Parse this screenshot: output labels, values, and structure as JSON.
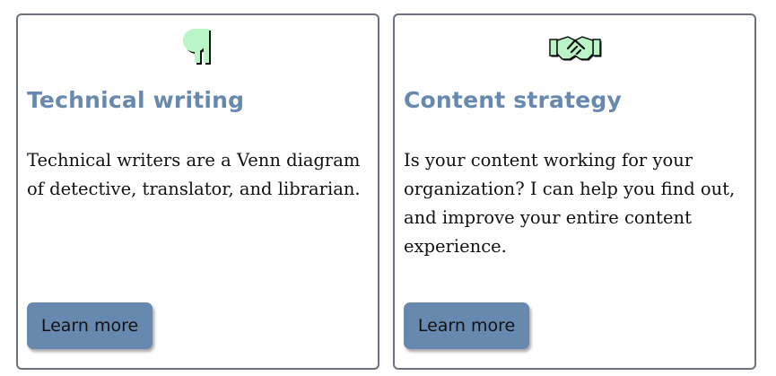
{
  "cards": [
    {
      "icon": "pilcrow-icon",
      "title": "Technical writing",
      "text": "Technical writers are a Venn diagram of detective, translator, and librarian.",
      "button_label": "Learn more"
    },
    {
      "icon": "handshake-icon",
      "title": "Content strategy",
      "text": "Is your content working for your organization? I can help you find out, and improve your entire content experience.",
      "button_label": "Learn more"
    }
  ],
  "colors": {
    "accent": "#6789b0",
    "icon_fill": "#b9f5c6",
    "border": "#6b7380",
    "text": "#111111"
  }
}
